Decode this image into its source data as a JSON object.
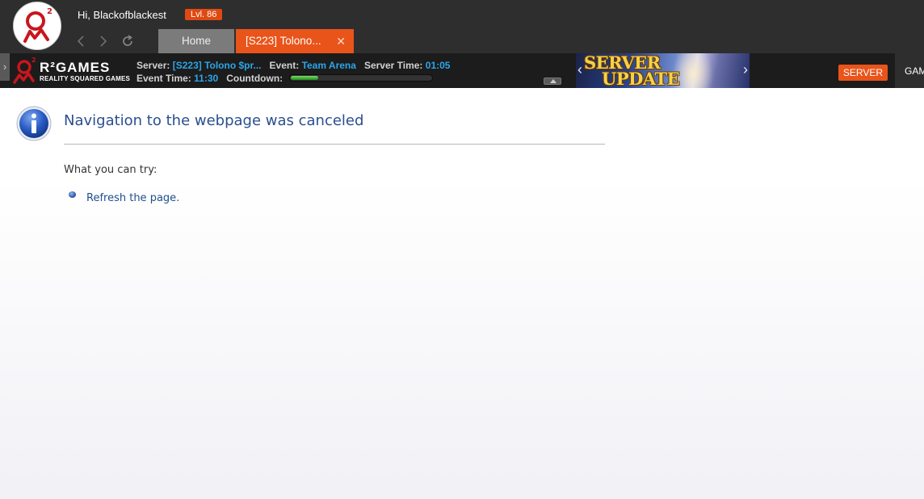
{
  "header": {
    "greeting": "Hi, Blackofblackest",
    "level": "Lvl. 86",
    "nav": {
      "back_icon": "chevron-left-icon",
      "forward_icon": "chevron-right-icon",
      "refresh_icon": "refresh-icon"
    },
    "tabs": [
      {
        "label": "Home",
        "active": false
      },
      {
        "label": "[S223] Tolono...",
        "active": true,
        "close": "✕"
      }
    ]
  },
  "infobar": {
    "toggle": "›",
    "brand": {
      "name": "R²GAMES",
      "tagline": "REALITY SQUARED GAMES"
    },
    "server_label": "Server:",
    "server_value": "[S223] Tolono $pr...",
    "event_label": "Event:",
    "event_value": "Team Arena",
    "server_time_label": "Server Time:",
    "server_time_value": "01:05",
    "event_time_label": "Event Time:",
    "event_time_value": "11:30",
    "countdown_label": "Countdown:",
    "countdown_progress": 0.2,
    "banner": {
      "line1": "SERVER",
      "line2": "UPDATE",
      "prev": "‹",
      "next": "›"
    },
    "server_button": "SERVER",
    "games_button": "GAMES"
  },
  "error_page": {
    "title": "Navigation to the webpage was canceled",
    "try_label": "What you can try:",
    "actions": [
      {
        "label": "Refresh the page."
      }
    ]
  },
  "colors": {
    "accent_orange": "#e9541a",
    "info_blue": "#2ca6e8",
    "title_blue": "#2a4f91",
    "bar_dark": "#2e2e2e"
  }
}
